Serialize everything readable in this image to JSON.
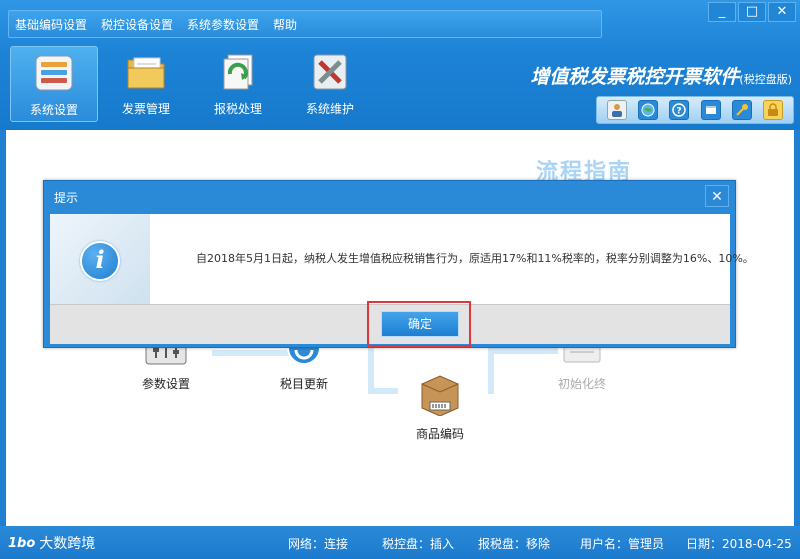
{
  "menu": [
    "基础编码设置",
    "税控设备设置",
    "系统参数设置",
    "帮助"
  ],
  "window_buttons": {
    "minimize": "_",
    "maximize": "□",
    "close": "✕"
  },
  "toolbar": [
    {
      "label": "系统设置",
      "icon": "settings-icon"
    },
    {
      "label": "发票管理",
      "icon": "invoice-folder-icon"
    },
    {
      "label": "报税处理",
      "icon": "tax-report-icon"
    },
    {
      "label": "系统维护",
      "icon": "maintenance-tools-icon"
    }
  ],
  "brand": {
    "title": "增值税发票税控开票软件",
    "subtitle": "(税控盘版)"
  },
  "content": {
    "guide_title": "流程指南",
    "nodes": [
      "参数设置",
      "税目更新",
      "商品编码",
      "初始化终"
    ]
  },
  "dialog": {
    "title": "提示",
    "message": "自2018年5月1日起，纳税人发生增值税应税销售行为，原适用17%和11%税率的，税率分别调整为16%、10%。",
    "ok_label": "确定",
    "close": "✕"
  },
  "status": {
    "logo": "大数跨境",
    "logo_mark": "1bo",
    "network": "网络：连接",
    "tax_disk": "税控盘：插入",
    "report_disk": "报税盘：移除",
    "user": "用户名：管理员",
    "date": "日期：2018-04-25"
  },
  "colors": {
    "primary": "#1f7fd0",
    "highlight": "#e0383a",
    "guide": "#aad4f5"
  }
}
